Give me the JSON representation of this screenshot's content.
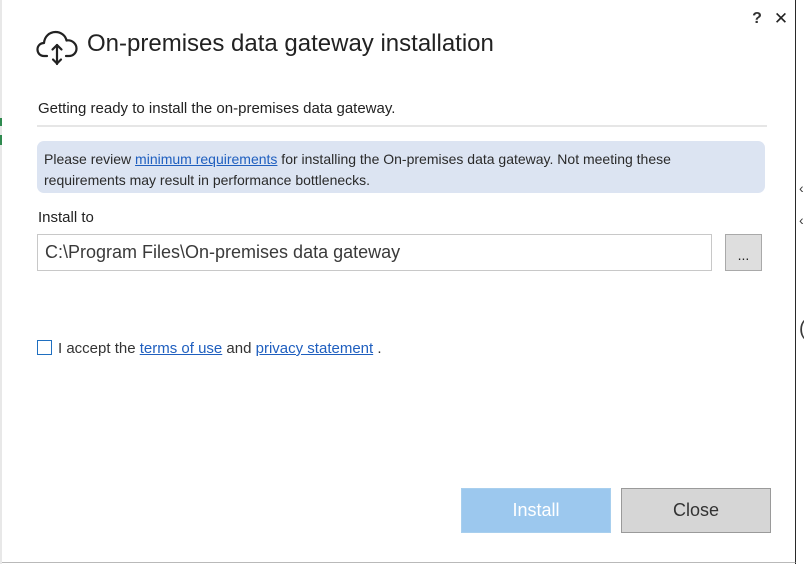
{
  "window": {
    "title": "On-premises data gateway installation",
    "help_label": "?",
    "close_label": "✕",
    "header_icon": "cloud-upload-icon"
  },
  "main": {
    "subtitle": "Getting ready to install the on-premises data gateway.",
    "info": {
      "prefix": "Please review ",
      "link": "minimum requirements",
      "suffix": " for installing the On-premises data gateway. Not meeting these requirements may result in performance bottlenecks."
    },
    "install_to": {
      "label": "Install to",
      "value": "C:\\Program Files\\On-premises data gateway",
      "browse_label": "..."
    },
    "accept": {
      "checked": false,
      "prefix": "I accept the ",
      "terms_link": "terms of use",
      "middle": " and ",
      "privacy_link": "privacy statement",
      "suffix": " ."
    }
  },
  "footer": {
    "install_label": "Install",
    "close_label": "Close"
  },
  "colors": {
    "link": "#1f5fbf",
    "info_background": "#dce4f2",
    "install_disabled": "#9cc8ee",
    "close_button": "#d6d6d6"
  }
}
